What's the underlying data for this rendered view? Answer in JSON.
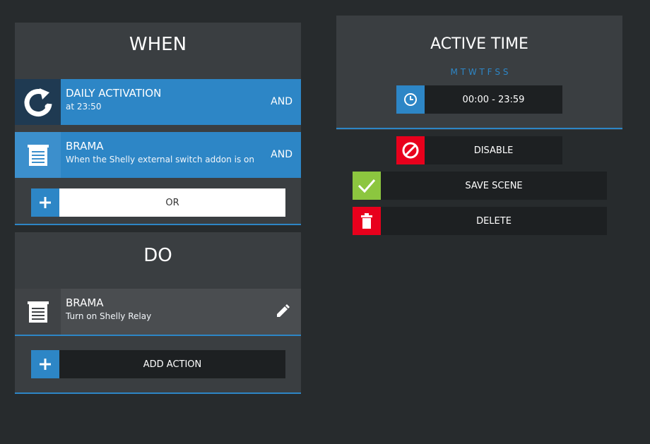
{
  "when": {
    "title": "WHEN",
    "conditions": [
      {
        "title": "DAILY ACTIVATION",
        "subtitle": "at 23:50",
        "connector": "AND",
        "icon": "refresh-icon"
      },
      {
        "title": "BRAMA",
        "subtitle": "When the Shelly external switch addon is on",
        "connector": "AND",
        "icon": "blinds-icon"
      }
    ],
    "or_button": {
      "label": "OR",
      "icon": "plus-icon"
    }
  },
  "do": {
    "title": "DO",
    "actions": [
      {
        "title": "BRAMA",
        "subtitle": "Turn on Shelly Relay",
        "icon": "blinds-icon",
        "edit_icon": "pencil-icon"
      }
    ],
    "add_action": {
      "label": "ADD ACTION",
      "icon": "plus-icon"
    }
  },
  "active_time": {
    "title": "ACTIVE TIME",
    "days": "M T W T F S S",
    "time_range": "00:00 - 23:59",
    "time_icon": "clock-icon"
  },
  "controls": {
    "disable": {
      "label": "DISABLE",
      "icon": "block-icon",
      "color": "#e8001c"
    },
    "save": {
      "label": "SAVE SCENE",
      "icon": "check-icon",
      "color": "#8cc63f"
    },
    "delete": {
      "label": "DELETE",
      "icon": "trash-icon",
      "color": "#e8001c"
    }
  },
  "colors": {
    "accent": "#2d86c6",
    "panel": "#3a3e41",
    "background": "#272b2d",
    "button_dark": "#1d2022"
  }
}
